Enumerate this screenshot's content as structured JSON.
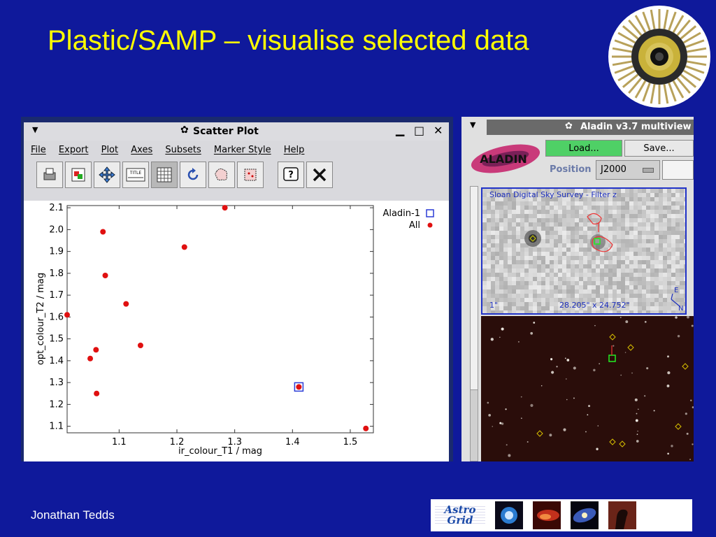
{
  "slide": {
    "title": "Plastic/SAMP – visualise selected data",
    "author": "Jonathan Tedds",
    "banner_logo": "Astro Grid"
  },
  "scatter_window": {
    "title": "Scatter Plot",
    "menu": [
      "File",
      "Export",
      "Plot",
      "Axes",
      "Subsets",
      "Marker Style",
      "Help"
    ],
    "toolbar_icons": [
      "print-icon",
      "image-export-icon",
      "move-icon",
      "title-icon",
      "grid-icon",
      "replot-icon",
      "blob-subset-icon",
      "region-subset-icon",
      "help-icon",
      "close-icon"
    ]
  },
  "chart_data": {
    "type": "scatter",
    "xlabel": "ir_colour_T1 / mag",
    "ylabel": "opt_colour_T2 / mag",
    "xlim": [
      1.01,
      1.54
    ],
    "ylim": [
      1.07,
      2.11
    ],
    "xticks": [
      "1.1",
      "1.2",
      "1.3",
      "1.4",
      "1.5"
    ],
    "yticks": [
      "1.1",
      "1.2",
      "1.3",
      "1.4",
      "1.5",
      "1.6",
      "1.7",
      "1.8",
      "1.9",
      "2.0",
      "2.1"
    ],
    "legend": [
      {
        "name": "Aladin-1",
        "marker": "open-square",
        "color": "#2b3cd6"
      },
      {
        "name": "All",
        "marker": "dot",
        "color": "#e01010"
      }
    ],
    "series": [
      {
        "name": "All",
        "points": [
          [
            1.283,
            2.1
          ],
          [
            1.072,
            1.99
          ],
          [
            1.076,
            1.79
          ],
          [
            1.213,
            1.92
          ],
          [
            1.112,
            1.66
          ],
          [
            1.137,
            1.47
          ],
          [
            1.06,
            1.45
          ],
          [
            1.05,
            1.41
          ],
          [
            1.01,
            1.61
          ],
          [
            1.061,
            1.25
          ],
          [
            1.411,
            1.28
          ],
          [
            1.527,
            1.09
          ]
        ]
      },
      {
        "name": "Aladin-1",
        "points": [
          [
            1.411,
            1.28
          ]
        ]
      }
    ]
  },
  "aladin_window": {
    "title": "Aladin v3.7 multiview",
    "load_label": "Load...",
    "save_label": "Save...",
    "position_label": "Position",
    "frame_value": "J2000",
    "survey_label": "Sloan Digital Sky Survey - Filter z",
    "scale_text": "28.205\" x 24.752\"",
    "compass_e": "E",
    "compass_n": "N",
    "corner_label": "1\"",
    "logo_text": "ALADIN"
  },
  "colors": {
    "slide_bg": "#0f199b",
    "title": "#ffff00",
    "load_button": "#4fd066",
    "selection_box": "#2133c8"
  }
}
